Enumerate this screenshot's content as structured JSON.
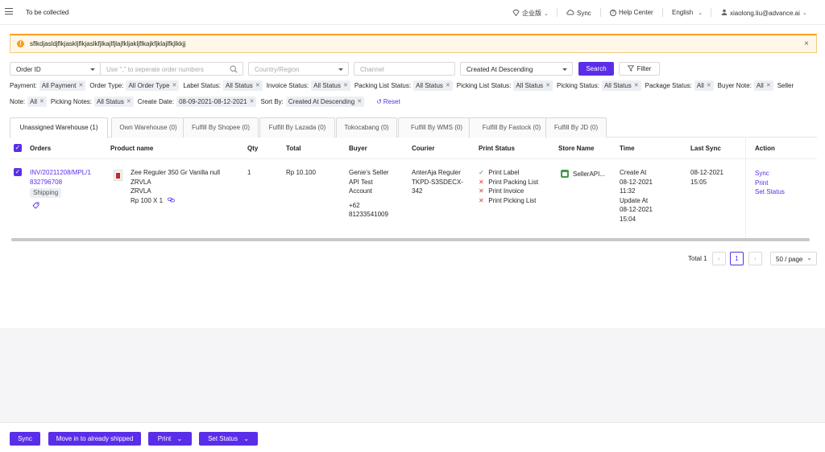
{
  "header": {
    "title": "To be collected",
    "edition": "企业版",
    "sync": "Sync",
    "help": "Help Center",
    "language": "English",
    "user": "xiaolong.liu@advance.ai"
  },
  "alert": {
    "message": "sflkdjasldjflkjaskljflkjaslkfjlkajlfjlajfkljakljflkajkfjklajlfkjlkkjj"
  },
  "search": {
    "field": "Order ID",
    "placeholder": "Use \",\" to seperate order numbers",
    "country_placeholder": "Country/Region",
    "channel_placeholder": "Channel",
    "sort": "Created At Descending",
    "search_button": "Search",
    "filter_button": "Filter"
  },
  "filters": {
    "payment_label": "Payment:",
    "payment_value": "All Payment",
    "order_type_label": "Order Type:",
    "order_type_value": "All Order Type",
    "label_status_label": "Label Status:",
    "label_status_value": "All Status",
    "invoice_status_label": "Invoice Status:",
    "invoice_status_value": "All Status",
    "packing_list_status_label": "Packing List Status:",
    "packing_list_status_value": "All Status",
    "picking_list_status_label": "Picking List Status:",
    "picking_list_status_value": "All Status",
    "picking_status_label": "Picking Status:",
    "picking_status_value": "All Status",
    "package_status_label": "Package Status:",
    "package_status_value": "All",
    "buyer_note_label": "Buyer Note:",
    "buyer_note_value": "All",
    "seller_note_label_a": "Seller",
    "seller_note_label_b": "Note:",
    "seller_note_value": "All",
    "picking_notes_label": "Picking Notes:",
    "picking_notes_value": "All Status",
    "create_date_label": "Create Date:",
    "create_date_value": "08-09-2021-08-12-2021",
    "sort_by_label": "Sort By:",
    "sort_by_value": "Created At Descending",
    "reset": "Reset"
  },
  "tabs": [
    {
      "label": "Unassigned Warehouse (1)"
    },
    {
      "label": "Own Warehouse (0)"
    },
    {
      "label": "Fulfill By Shopee (0)"
    },
    {
      "label": "Fulfill By Lazada (0)"
    },
    {
      "label": "Tokocabang (0)"
    },
    {
      "label": "Fulfill By WMS (0)"
    },
    {
      "label": "Fulfill By Fastock (0)"
    },
    {
      "label": "Fulfill By JD (0)"
    }
  ],
  "table": {
    "headers": [
      "Orders",
      "Product name",
      "Qty",
      "Total",
      "Buyer",
      "Courier",
      "Print Status",
      "Store Name",
      "Time",
      "Last Sync",
      "Action"
    ],
    "row": {
      "order_line1": "INV/20211208/MPL/1",
      "order_line2": "832796708",
      "order_badge": "Shipping",
      "product_name": "Zee Reguler 350 Gr Vanilla null",
      "sku1": "ZRVLA",
      "sku2": "ZRVLA",
      "price_qty": "Rp 100 X 1",
      "qty": "1",
      "total": "Rp 10.100",
      "buyer_line1": "Genie's Seller",
      "buyer_line2": "API Test",
      "buyer_line3": "Account",
      "buyer_phone1": "+62",
      "buyer_phone2": "81233541009",
      "courier_line1": "AnterAja Reguler",
      "courier_line2": "TKPD-S3SDECX-",
      "courier_line3": "342",
      "print_status": [
        {
          "label": "Print Label",
          "done": true
        },
        {
          "label": "Print Packing List",
          "done": false
        },
        {
          "label": "Print Invoice",
          "done": false
        },
        {
          "label": "Print Picking List",
          "done": false
        }
      ],
      "store_name": "SellerAPI...",
      "time_create_label": "Create At",
      "time_create_date": "08-12-2021",
      "time_create_time": "11:32",
      "time_update_label": "Update At",
      "time_update_date": "08-12-2021",
      "time_update_time": "15:04",
      "last_sync_date": "08-12-2021",
      "last_sync_time": "15:05",
      "actions": [
        "Sync",
        "Print",
        "Set Status"
      ]
    }
  },
  "pagination": {
    "total": "Total 1",
    "page": "1",
    "page_size": "50 / page"
  },
  "footer": {
    "sync": "Sync",
    "move": "Move in to already shipped",
    "print": "Print",
    "set_status": "Set Status"
  },
  "colors": {
    "primary": "#5a2ee8",
    "warning": "#fa9f1f",
    "success": "#2c9b3c",
    "error": "#e0372f"
  }
}
